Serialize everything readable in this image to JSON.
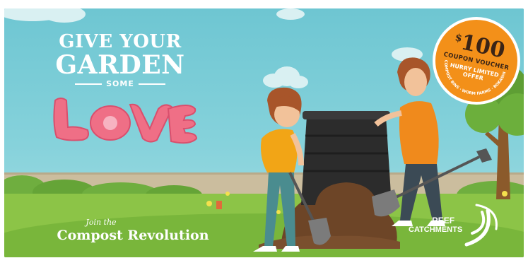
{
  "headline": {
    "line1": "GIVE YOUR",
    "line2": "GARDEN",
    "line3": "SOME",
    "love": "LOVE"
  },
  "cta": {
    "small": "Join the",
    "big": "Compost Revolution"
  },
  "coupon": {
    "currency": "$",
    "amount": "100",
    "label": "COUPON VOUCHER",
    "urgency_line1": "HURRY LIMITED",
    "urgency_line2": "OFFER",
    "arc_text": "COMPOST BINS · WORM FARMS · BOKASHI BINS"
  },
  "brand": {
    "line1": "REEF",
    "line2": "CATCHMENTS"
  },
  "colors": {
    "sky": "#7ccbd6",
    "grass": "#8cc447",
    "coupon_orange": "#f39019",
    "love_pink": "#ef6f86",
    "bin": "#2c2c2c"
  },
  "icons": [
    "woman-gardener-illustration",
    "man-gardener-illustration",
    "compost-bin-illustration",
    "shovel-icon",
    "tree-illustration",
    "reef-wave-logo-icon"
  ]
}
